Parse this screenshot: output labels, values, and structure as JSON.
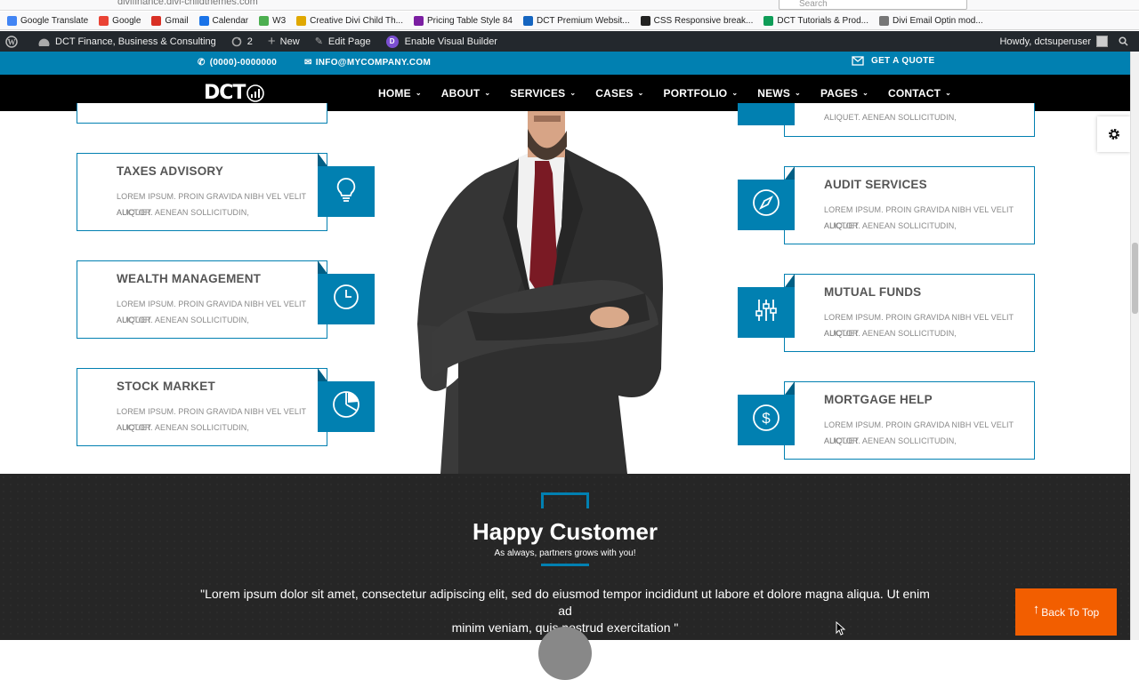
{
  "browser": {
    "url": "divifinance.divi-childthemes.com",
    "search_placeholder": "Search",
    "bookmarks": [
      {
        "label": "Google Translate",
        "icon": "translate-icon",
        "color": "#4285f4"
      },
      {
        "label": "Google",
        "icon": "google-icon",
        "color": "#ea4335"
      },
      {
        "label": "Gmail",
        "icon": "gmail-icon",
        "color": "#d93025"
      },
      {
        "label": "Calendar",
        "icon": "calendar-icon",
        "color": "#1a73e8"
      },
      {
        "label": "W3",
        "icon": "w3-icon",
        "color": "#4caf50"
      },
      {
        "label": "Creative Divi Child Th...",
        "icon": "bookmark-icon",
        "color": "#e0a800"
      },
      {
        "label": "Pricing Table Style 84",
        "icon": "jr-icon",
        "color": "#7b1fa2"
      },
      {
        "label": "DCT Premium Websit...",
        "icon": "bookmark-icon",
        "color": "#1565c0"
      },
      {
        "label": "CSS Responsive break...",
        "icon": "github-icon",
        "color": "#222222"
      },
      {
        "label": "DCT Tutorials & Prod...",
        "icon": "sheet-icon",
        "color": "#0f9d58"
      },
      {
        "label": "Divi Email Optin mod...",
        "icon": "bookmark-icon",
        "color": "#777777"
      }
    ]
  },
  "wpbar": {
    "site_name": "DCT Finance, Business & Consulting",
    "updates": "2",
    "new": "New",
    "edit": "Edit Page",
    "builder": "Enable Visual Builder",
    "howdy": "Howdy, dctsuperuser"
  },
  "topbar": {
    "phone": "(0000)-0000000",
    "email": "INFO@MYCOMPANY.COM",
    "quote": "GET A QUOTE"
  },
  "nav": {
    "logo": "DCT",
    "items": [
      "HOME",
      "ABOUT",
      "SERVICES",
      "CASES",
      "PORTFOLIO",
      "NEWS",
      "PAGES",
      "CONTACT"
    ]
  },
  "services": {
    "left": [
      {
        "title": "TAXES ADVISORY",
        "desc1": "LOREM IPSUM. PROIN GRAVIDA NIBH VEL VELIT AUCTOR",
        "desc2": "ALIQUET. AENEAN SOLLICITUDIN,",
        "icon": "lightbulb-icon"
      },
      {
        "title": "WEALTH MANAGEMENT",
        "desc1": "LOREM IPSUM. PROIN GRAVIDA NIBH VEL VELIT AUCTOR",
        "desc2": "ALIQUET. AENEAN SOLLICITUDIN,",
        "icon": "clock-icon"
      },
      {
        "title": "STOCK MARKET",
        "desc1": "LOREM IPSUM. PROIN GRAVIDA NIBH VEL VELIT AUCTOR",
        "desc2": "ALIQUET. AENEAN SOLLICITUDIN,",
        "icon": "pie-chart-icon"
      }
    ],
    "right_top_partial": "ALIQUET. AENEAN SOLLICITUDIN,",
    "right": [
      {
        "title": "AUDIT SERVICES",
        "desc1": "LOREM IPSUM. PROIN GRAVIDA NIBH VEL VELIT AUCTOR",
        "desc2": "ALIQUET. AENEAN SOLLICITUDIN,",
        "icon": "compass-icon"
      },
      {
        "title": "MUTUAL FUNDS",
        "desc1": "LOREM IPSUM. PROIN GRAVIDA NIBH VEL VELIT AUCTOR",
        "desc2": "ALIQUET. AENEAN SOLLICITUDIN,",
        "icon": "sliders-icon"
      },
      {
        "title": "MORTGAGE HELP",
        "desc1": "LOREM IPSUM. PROIN GRAVIDA NIBH VEL VELIT AUCTOR",
        "desc2": "ALIQUET. AENEAN SOLLICITUDIN,",
        "icon": "dollar-icon"
      }
    ]
  },
  "testimonial": {
    "title": "Happy Customer",
    "subtitle": "As always, partners grows with you!",
    "quote_line1": "\"Lorem ipsum dolor sit amet, consectetur adipiscing elit, sed do eiusmod tempor incididunt ut labore et dolore magna aliqua. Ut enim ad",
    "quote_line2": "minim veniam, quis nostrud exercitation \""
  },
  "back_to_top": "Back To Top",
  "colors": {
    "accent": "#0180b1",
    "dark": "#262626",
    "orange": "#f25e00"
  }
}
